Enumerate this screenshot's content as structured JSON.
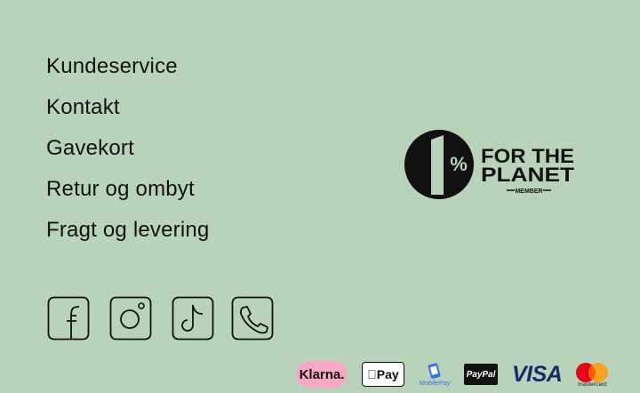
{
  "footer_links": [
    {
      "label": "Kundeservice"
    },
    {
      "label": "Kontakt"
    },
    {
      "label": "Gavekort"
    },
    {
      "label": "Retur og ombyt"
    },
    {
      "label": "Fragt og levering"
    }
  ],
  "one_percent_logo": {
    "number": "1",
    "percent": "%",
    "line1": "FOR THE",
    "line2": "PLANET",
    "line3": "MEMBER"
  },
  "social_icons": [
    "facebook-icon",
    "instagram-icon",
    "tiktok-icon",
    "phone-icon"
  ],
  "payments": {
    "klarna": "Klarna.",
    "applepay": "Pay",
    "mobilepay": "MobilePay",
    "paypal": "PayPal",
    "visa": "VISA",
    "mastercard": "mastercard"
  },
  "colors": {
    "background": "#b9d3ba",
    "text": "#111111",
    "klarna_pink": "#f6a8c4",
    "mastercard_red": "#eb001b",
    "mastercard_orange": "#f79e1b",
    "mobilepay_blue": "#3c6ff0",
    "visa_blue": "#1a2a6c"
  }
}
